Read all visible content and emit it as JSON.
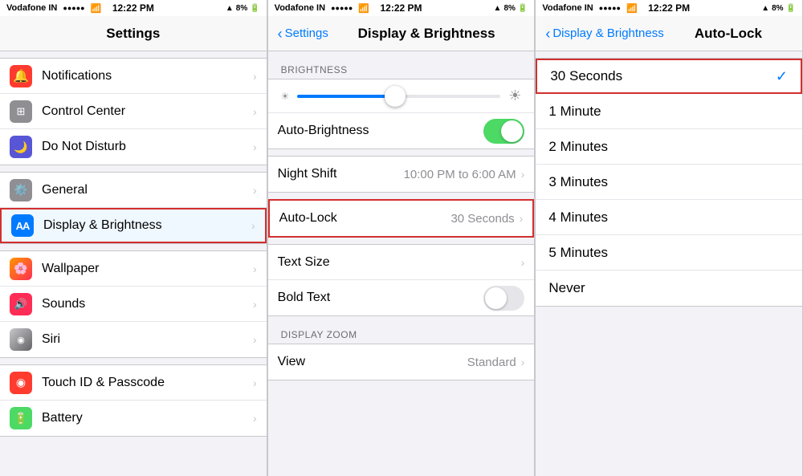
{
  "panel1": {
    "statusBar": {
      "carrier": "Vodafone IN",
      "signal": "●●●●●",
      "wifi": "WiFi",
      "time": "12:22 PM",
      "location": "▲",
      "battery": "8%"
    },
    "title": "Settings",
    "items": [
      {
        "id": "notifications",
        "label": "Notifications",
        "iconBg": "#ff3b30",
        "iconText": "🔔",
        "hasChevron": true
      },
      {
        "id": "control-center",
        "label": "Control Center",
        "iconBg": "#8e8e93",
        "iconText": "⊞",
        "hasChevron": true
      },
      {
        "id": "do-not-disturb",
        "label": "Do Not Disturb",
        "iconBg": "#5856d6",
        "iconText": "🌙",
        "hasChevron": true
      },
      {
        "id": "general",
        "label": "General",
        "iconBg": "#8e8e93",
        "iconText": "⚙️",
        "hasChevron": true
      },
      {
        "id": "display-brightness",
        "label": "Display & Brightness",
        "iconBg": "#007aff",
        "iconText": "AA",
        "hasChevron": true,
        "highlighted": true
      },
      {
        "id": "wallpaper",
        "label": "Wallpaper",
        "iconBg": "#ff9500",
        "iconText": "✿",
        "hasChevron": true
      },
      {
        "id": "sounds",
        "label": "Sounds",
        "iconBg": "#ff2d55",
        "iconText": "🔊",
        "hasChevron": true
      },
      {
        "id": "siri",
        "label": "Siri",
        "iconBg": "#c7c7cc",
        "iconText": "◉",
        "hasChevron": true
      },
      {
        "id": "touch-id",
        "label": "Touch ID & Passcode",
        "iconBg": "#ff3b30",
        "iconText": "◉",
        "hasChevron": true
      },
      {
        "id": "battery",
        "label": "Battery",
        "iconBg": "#4cd964",
        "iconText": "🔋",
        "hasChevron": true
      }
    ]
  },
  "panel2": {
    "statusBar": {
      "carrier": "Vodafone IN",
      "signal": "●●●●●",
      "time": "12:22 PM",
      "battery": "8%"
    },
    "backLabel": "Settings",
    "title": "Display & Brightness",
    "sectionBrightness": "BRIGHTNESS",
    "autoBrightnessLabel": "Auto-Brightness",
    "autoBrightnessOn": true,
    "nightShiftLabel": "Night Shift",
    "nightShiftValue": "10:00 PM to 6:00 AM",
    "autoLockLabel": "Auto-Lock",
    "autoLockValue": "30 Seconds",
    "textSizeLabel": "Text Size",
    "boldTextLabel": "Bold Text",
    "boldTextOn": false,
    "sectionDisplayZoom": "DISPLAY ZOOM",
    "viewLabel": "View",
    "viewValue": "Standard"
  },
  "panel3": {
    "statusBar": {
      "carrier": "Vodafone IN",
      "signal": "●●●●●",
      "time": "12:22 PM",
      "battery": "8%"
    },
    "backLabel": "Display & Brightness",
    "title": "Auto-Lock",
    "options": [
      {
        "id": "30-seconds",
        "label": "30 Seconds",
        "selected": true
      },
      {
        "id": "1-minute",
        "label": "1 Minute",
        "selected": false
      },
      {
        "id": "2-minutes",
        "label": "2 Minutes",
        "selected": false
      },
      {
        "id": "3-minutes",
        "label": "3 Minutes",
        "selected": false
      },
      {
        "id": "4-minutes",
        "label": "4 Minutes",
        "selected": false
      },
      {
        "id": "5-minutes",
        "label": "5 Minutes",
        "selected": false
      },
      {
        "id": "never",
        "label": "Never",
        "selected": false
      }
    ]
  }
}
